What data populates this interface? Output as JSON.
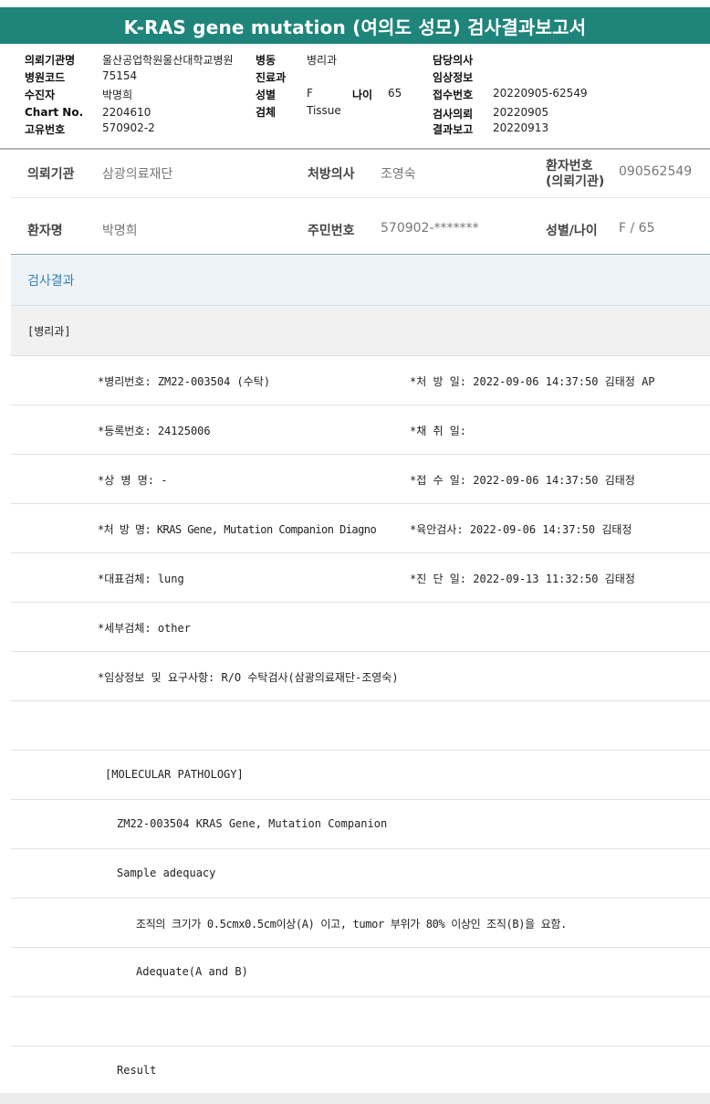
{
  "title": "K-RAS gene mutation (여의도 성모) 검사결과보고서",
  "header": {
    "col1": [
      {
        "label": "의뢰기관명",
        "value": "울산공업학원울산대학교병원"
      },
      {
        "label": "병원코드",
        "value": "75154"
      },
      {
        "label": "수진자",
        "value": "박명희"
      },
      {
        "label": "Chart No.",
        "value": "2204610"
      },
      {
        "label": "고유번호",
        "value": "570902-2"
      }
    ],
    "col2": [
      {
        "label": "병동",
        "value": "병리과"
      },
      {
        "label": "진료과",
        "value": ""
      },
      {
        "label": "성별",
        "value": "F"
      },
      {
        "label": "검체",
        "value": "Tissue"
      }
    ],
    "age": {
      "label": "나이",
      "value": "65"
    },
    "col3": [
      {
        "label": "담당의사",
        "value": ""
      },
      {
        "label": "임상정보",
        "value": ""
      },
      {
        "label": "접수번호",
        "value": "20220905-62549"
      },
      {
        "label": "검사의뢰",
        "value": "20220905"
      },
      {
        "label": "결과보고",
        "value": "20220913"
      }
    ]
  },
  "info": {
    "institution_label": "의뢰기관",
    "institution_value": "삼광의료재단",
    "doctor_label": "처방의사",
    "doctor_value": "조영숙",
    "patient_no_label_1": "환자번호",
    "patient_no_label_2": "(의뢰기관)",
    "patient_no_value": "090562549",
    "name_label": "환자명",
    "name_value": "박명희",
    "rrn_label": "주민번호",
    "rrn_value": "570902-*******",
    "sexage_label": "성별/나이",
    "sexage_value": "F / 65"
  },
  "results": {
    "header": "검사결과",
    "dept": "[병리과]",
    "rows": [
      {
        "left": "*병리번호: ZM22-003504 (수탁)",
        "right": "*처 방 일: 2022-09-06 14:37:50  김태정 AP"
      },
      {
        "left": "*등록번호: 24125006",
        "right": "*채 취 일:"
      },
      {
        "left": "*상 병 명: -",
        "right": "*접 수 일: 2022-09-06 14:37:50  김태정"
      },
      {
        "left": "*처 방 명: KRAS Gene, Mutation Companion Diagno",
        "right": "*육안검사: 2022-09-06 14:37:50  김태정"
      },
      {
        "left": "*대표검체: lung",
        "right": "*진 단 일: 2022-09-13 11:32:50  김태정"
      },
      {
        "left": "*세부검체: other",
        "right": ""
      },
      {
        "left": "*임상정보 및 요구사항: R/O 수탁검사(삼광의료재단-조영숙)",
        "right": ""
      },
      {
        "left": "",
        "right": ""
      },
      {
        "left": "[MOLECULAR PATHOLOGY]",
        "right": ""
      },
      {
        "left": "ZM22-003504     KRAS Gene, Mutation Companion",
        "right": ""
      },
      {
        "left": "Sample adequacy",
        "right": ""
      },
      {
        "left": "조직의 크기가 0.5cmx0.5cm이상(A) 이고, tumor 부위가 80% 이상인 조직(B)을 요함.",
        "right": ""
      },
      {
        "left": "Adequate(A and B)",
        "right": ""
      },
      {
        "left": "",
        "right": ""
      },
      {
        "left": "Result",
        "right": ""
      }
    ]
  }
}
